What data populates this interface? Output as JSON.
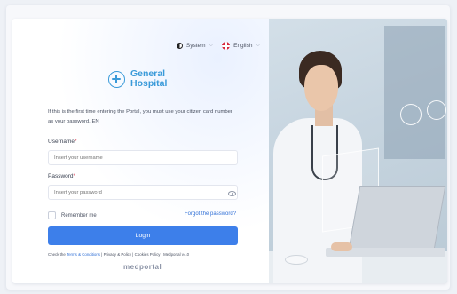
{
  "header": {
    "theme_label": "System",
    "language_label": "English"
  },
  "logo": {
    "line1": "General",
    "line2": "Hospital"
  },
  "intro": "If this is the first time entering the Portal, you must use your citizen card number as your password. EN",
  "form": {
    "username_label": "Username",
    "username_placeholder": "Insert your username",
    "password_label": "Password",
    "password_placeholder": "Insert your password",
    "required_marker": "*",
    "remember_label": "Remember me",
    "forgot_label": "Forgot the password?",
    "login_label": "Login"
  },
  "footer": {
    "prefix": "Check the ",
    "terms": "Terms & Conditions",
    "sep1": " | ",
    "privacy": "Privacy & Policy",
    "sep2": " | ",
    "cookies": "Cookies Policy",
    "sep3": " | ",
    "version": "Medportal v4.0",
    "brand": "medportal"
  },
  "colors": {
    "accent": "#3d7fea",
    "logo": "#3a9ad9",
    "required": "#e0455a"
  },
  "icons": [
    "theme-icon",
    "flag-icon",
    "chevron-down-icon",
    "eye-icon",
    "cross-logo-icon"
  ]
}
